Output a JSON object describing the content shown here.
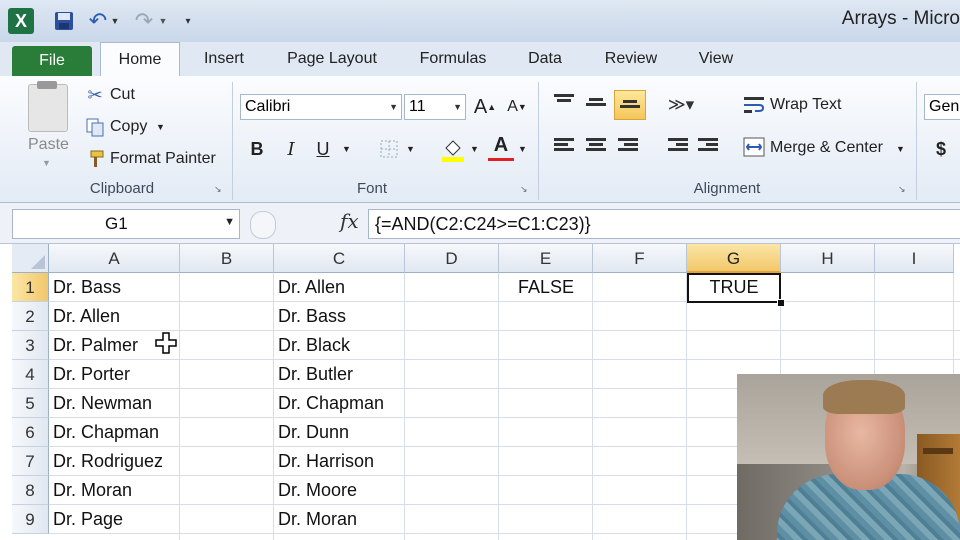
{
  "titlebar": {
    "app_title": "Arrays - Micro",
    "logo_letter": "X"
  },
  "tabs": [
    {
      "label": "File"
    },
    {
      "label": "Home"
    },
    {
      "label": "Insert"
    },
    {
      "label": "Page Layout"
    },
    {
      "label": "Formulas"
    },
    {
      "label": "Data"
    },
    {
      "label": "Review"
    },
    {
      "label": "View"
    }
  ],
  "clipboard": {
    "paste": "Paste",
    "cut": "Cut",
    "copy": "Copy",
    "format_painter": "Format Painter",
    "group_label": "Clipboard"
  },
  "font": {
    "name": "Calibri",
    "size": "11",
    "grow": "A",
    "shrink": "A",
    "bold": "B",
    "italic": "I",
    "underline": "U",
    "font_color_letter": "A",
    "group_label": "Font",
    "highlight_color": "#ffff00",
    "font_color": "#e02020"
  },
  "alignment": {
    "wrap_text": "Wrap Text",
    "merge_center": "Merge & Center",
    "group_label": "Alignment"
  },
  "number": {
    "format_partial": "Gen",
    "currency": "$"
  },
  "formula_bar": {
    "name_box": "G1",
    "fx": "fx",
    "formula": "{=AND(C2:C24>=C1:C23)}"
  },
  "grid": {
    "columns": [
      "A",
      "B",
      "C",
      "D",
      "E",
      "F",
      "G",
      "H",
      "I"
    ],
    "rows": [
      "1",
      "2",
      "3",
      "4",
      "5",
      "6",
      "7",
      "8",
      "9"
    ],
    "selected_column": "G",
    "selected_row": "1",
    "column_a": [
      "Dr. Bass",
      "Dr. Allen",
      "Dr. Palmer",
      "Dr. Porter",
      "Dr. Newman",
      "Dr. Chapman",
      "Dr. Rodriguez",
      "Dr. Moran",
      "Dr. Page"
    ],
    "column_c": [
      "Dr. Allen",
      "Dr. Bass",
      "Dr. Black",
      "Dr. Butler",
      "Dr. Chapman",
      "Dr. Dunn",
      "Dr. Harrison",
      "Dr. Moore",
      "Dr. Moran"
    ],
    "e1": "FALSE",
    "g1": "TRUE"
  },
  "colors": {
    "file_tab": "#2a7d38",
    "selection_header": "#f2c76b"
  }
}
